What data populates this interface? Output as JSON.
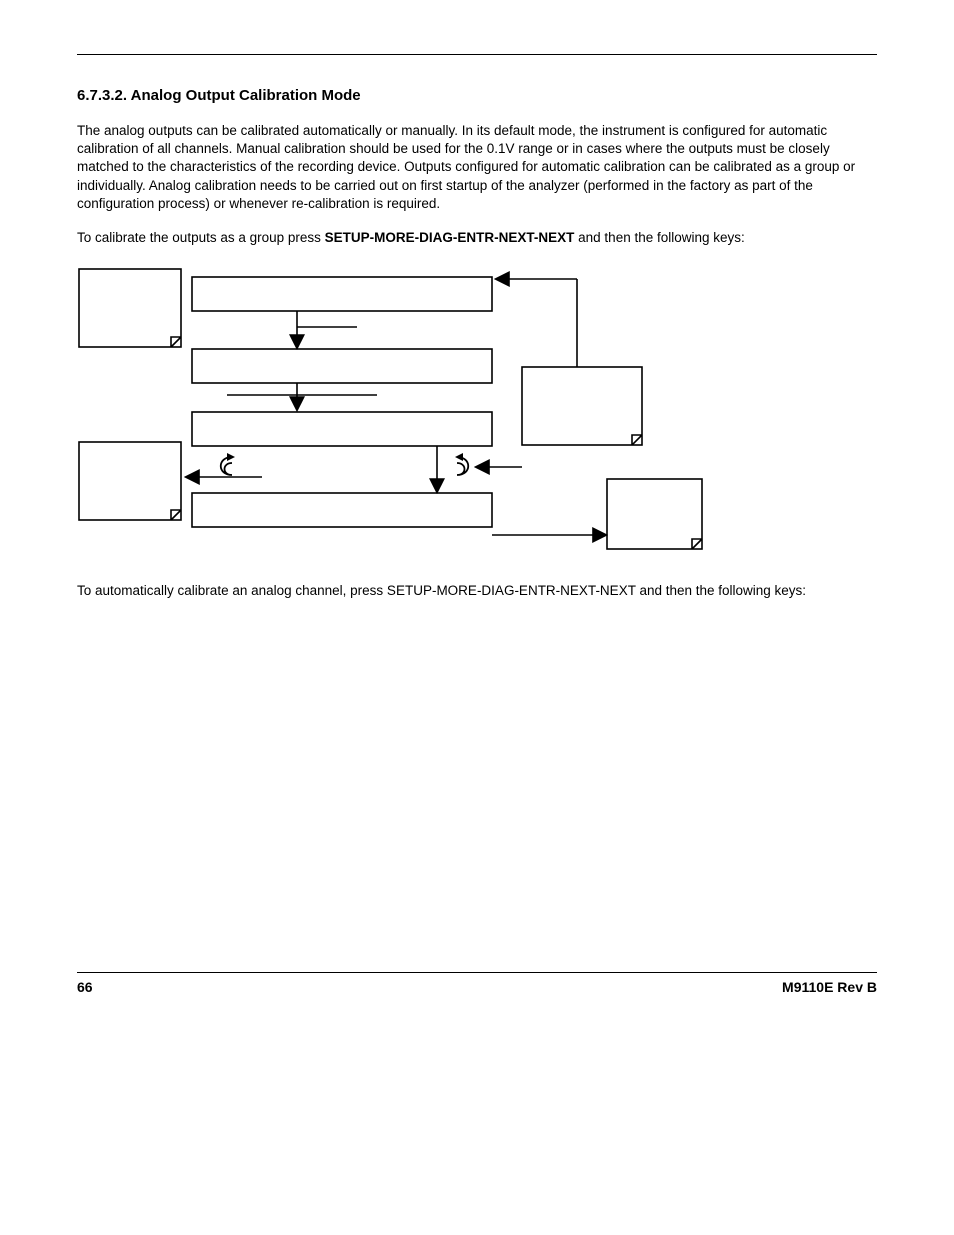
{
  "section": {
    "number": "6.7.3.2.",
    "title": "Analog Output Calibration Mode"
  },
  "para1": "The analog outputs can be calibrated automatically or manually. In its default mode, the instrument is configured for automatic calibration of all channels. Manual calibration should be used for the 0.1V range or in cases where the outputs must be closely matched to the characteristics of the recording device. Outputs configured for automatic calibration can be calibrated as a group or individually. Analog calibration needs to be carried out on first startup of the analyzer (performed in the factory as part of the configuration process) or whenever re-calibration is required.",
  "para2_pre": "To calibrate the outputs as a group press ",
  "para2_bold": "SETUP-MORE-DIAG-ENTR-NEXT-NEXT",
  "para2_post": " and then the following keys:",
  "para3": "To automatically calibrate an analog channel, press SETUP-MORE-DIAG-ENTR-NEXT-NEXT and then the following keys:",
  "footer": {
    "page": "66",
    "doc": "M9110E Rev B"
  }
}
